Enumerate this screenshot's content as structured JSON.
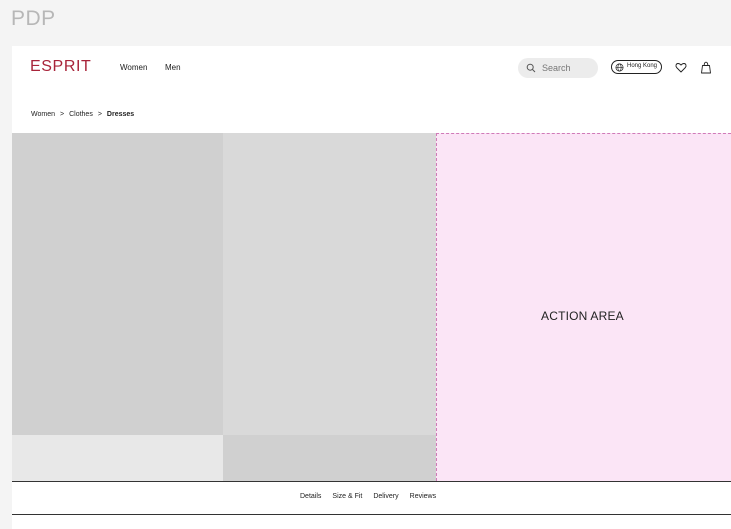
{
  "page": {
    "label": "PDP"
  },
  "header": {
    "logo": "ESPRIT",
    "nav": [
      {
        "label": "Women"
      },
      {
        "label": "Men"
      }
    ],
    "search": {
      "placeholder": "Search",
      "icon": "search-icon"
    },
    "locale": {
      "label": "Hong Kong",
      "icon": "globe-icon"
    },
    "icons": {
      "wishlist": "heart-icon",
      "bag": "shopping-bag-icon"
    }
  },
  "breadcrumb": {
    "items": [
      {
        "label": "Women"
      },
      {
        "label": "Clothes"
      },
      {
        "label": "Dresses"
      }
    ],
    "separator": ">"
  },
  "action_area": {
    "label": "ACTION AREA"
  },
  "tabs": [
    {
      "label": "Details"
    },
    {
      "label": "Size & Fit"
    },
    {
      "label": "Delivery"
    },
    {
      "label": "Reviews"
    }
  ],
  "colors": {
    "brand": "#a8243a",
    "action_area_bg": "#fbe5f6",
    "action_area_border": "#d07ab8"
  }
}
